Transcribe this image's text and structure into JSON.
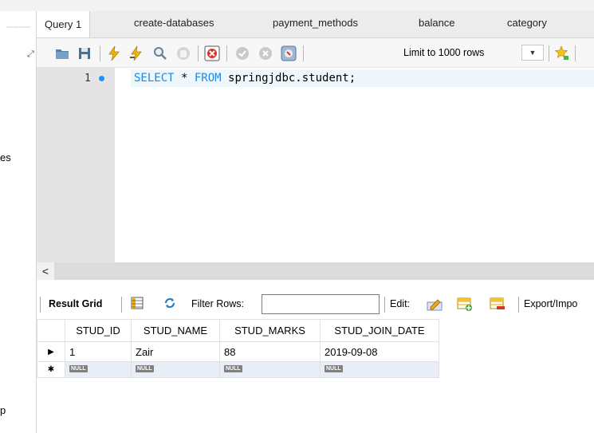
{
  "left_panel": {
    "fragment_1": "es",
    "fragment_2": "p"
  },
  "tabs": [
    {
      "label": "Query 1",
      "active": true
    },
    {
      "label": "create-databases"
    },
    {
      "label": "payment_methods"
    },
    {
      "label": "balance"
    },
    {
      "label": "category"
    }
  ],
  "toolbar": {
    "limit_label": "Limit to 1000 rows",
    "icons": [
      "open-folder-icon",
      "save-icon",
      "execute-lightning-icon",
      "execute-cursor-lightning-icon",
      "explain-magnifier-icon",
      "stop-icon",
      "toggle-continue-on-error-icon",
      "commit-icon",
      "rollback-icon",
      "autocommit-icon",
      "limit-dropdown-icon",
      "beautify-star-icon"
    ]
  },
  "editor": {
    "line_number": "1",
    "code_keyword_1": "SELECT",
    "code_middle": " * ",
    "code_keyword_2": "FROM",
    "code_rest": " springjdbc.student;"
  },
  "result_toolbar": {
    "result_grid_label": "Result Grid",
    "filter_label": "Filter Rows:",
    "filter_value": "",
    "edit_label": "Edit:",
    "export_label": "Export/Impo"
  },
  "grid": {
    "columns": [
      "STUD_ID",
      "STUD_NAME",
      "STUD_MARKS",
      "STUD_JOIN_DATE"
    ],
    "rows": [
      [
        "1",
        "Zair",
        "88",
        "2019-09-08"
      ]
    ],
    "new_row_placeholder": "NULL"
  },
  "colors": {
    "keyword": "#1e88e5",
    "breakpoint": "#1e90ff",
    "null_badge": "#808080"
  }
}
